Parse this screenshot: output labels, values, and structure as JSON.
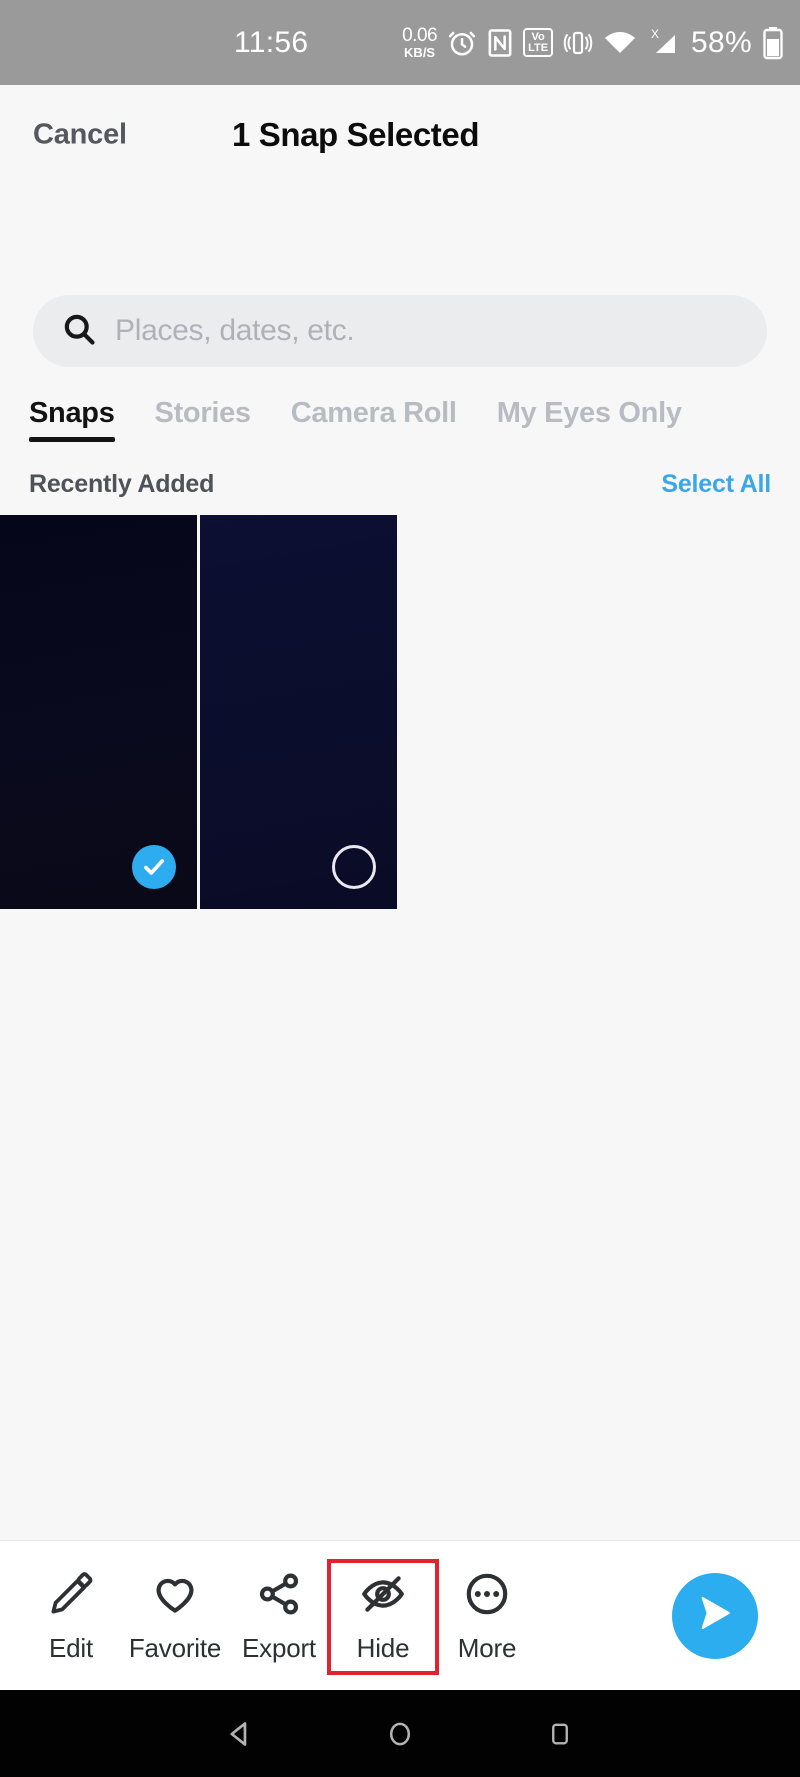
{
  "status_bar": {
    "time": "11:56",
    "data_rate_value": "0.06",
    "data_rate_unit": "KB/S",
    "icons": [
      "alarm-icon",
      "nfc-icon",
      "volte-icon",
      "vibrate-icon",
      "wifi-icon",
      "cellular-signal-icon"
    ],
    "volte_top": "Vo",
    "volte_bottom": "LTE",
    "signal_x": "X",
    "battery_percent": "58%",
    "background_color": "#9a9a9a"
  },
  "header": {
    "cancel_label": "Cancel",
    "title": "1 Snap Selected"
  },
  "search": {
    "placeholder": "Places, dates, etc.",
    "value": "",
    "icon": "search-icon"
  },
  "tabs": [
    {
      "label": "Snaps",
      "active": true
    },
    {
      "label": "Stories",
      "active": false
    },
    {
      "label": "Camera Roll",
      "active": false
    },
    {
      "label": "My Eyes Only",
      "active": false
    }
  ],
  "section": {
    "title": "Recently Added",
    "select_all_label": "Select All",
    "select_all_color": "#3aa8e8"
  },
  "grid": {
    "items": [
      {
        "name": "snap-thumbnail-1",
        "selected": true,
        "badge_icon": "check-icon",
        "color": "#06061a"
      },
      {
        "name": "snap-thumbnail-2",
        "selected": false,
        "badge_icon": "empty-circle-icon",
        "color": "#0d0f33"
      }
    ],
    "selected_badge_color": "#2dadef"
  },
  "toolbar": {
    "items": [
      {
        "label": "Edit",
        "icon": "pencil-icon",
        "highlighted": false
      },
      {
        "label": "Favorite",
        "icon": "heart-icon",
        "highlighted": false
      },
      {
        "label": "Export",
        "icon": "share-icon",
        "highlighted": false
      },
      {
        "label": "Hide",
        "icon": "eye-slash-icon",
        "highlighted": true
      },
      {
        "label": "More",
        "icon": "ellipsis-circle-icon",
        "highlighted": false
      }
    ],
    "highlight_color": "#e0232e",
    "send_button": {
      "icon": "send-arrow-icon",
      "color": "#2cadef"
    }
  },
  "nav_bar": {
    "buttons": [
      {
        "name": "back-button",
        "icon": "triangle-back-icon"
      },
      {
        "name": "home-button",
        "icon": "circle-home-icon"
      },
      {
        "name": "recents-button",
        "icon": "square-recents-icon"
      }
    ],
    "background_color": "#020202"
  }
}
